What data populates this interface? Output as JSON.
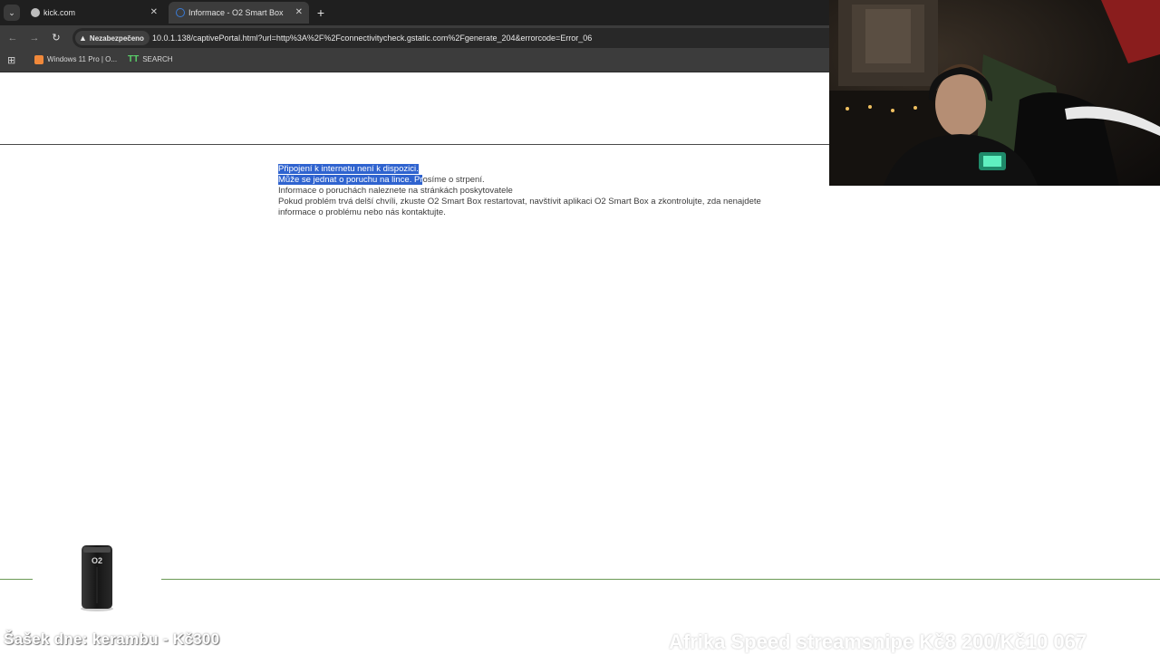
{
  "browser": {
    "tabs": [
      {
        "title": "kick.com",
        "active": false
      },
      {
        "title": "Informace - O2 Smart Box",
        "active": true
      }
    ],
    "new_tab_symbol": "+",
    "close_symbol": "✕",
    "security_label": "Nezabezpečeno",
    "url": "10.0.1.138/captivePortal.html?url=http%3A%2F%2Fconnectivitycheck.gstatic.com%2Fgenerate_204&errorcode=Error_06",
    "bookmarks": [
      {
        "label": "Windows 11 Pro | O..."
      },
      {
        "label": "SEARCH"
      }
    ]
  },
  "page": {
    "selected_line_1": "Připojení k internetu není k dispozici.",
    "selected_line_2": "Může se jednat o poruchu na lince. Pr",
    "line_2_rest": "osíme o strpení.",
    "line_3": "Informace o poruchách naleznete na stránkách poskytovatele",
    "line_4": "Pokud problém trvá delší chvíli, zkuste O2 Smart Box restartovat, navštívit aplikaci O2 Smart Box a zkontrolujte, zda nenajdete informace o problému nebo nás kontaktujte.",
    "device_logo_text": "O2"
  },
  "overlays": {
    "left_text": "Šašek dne: kerambu - Kč300",
    "right_text": "Afrika Speed streamsnipe Kč8 200/Kč10 067"
  },
  "colors": {
    "selection": "#2f63cf",
    "chrome_dark": "#1f1f1f",
    "chrome_toolbar": "#3c3c3c",
    "divider_bottom": "#6a9a55"
  }
}
